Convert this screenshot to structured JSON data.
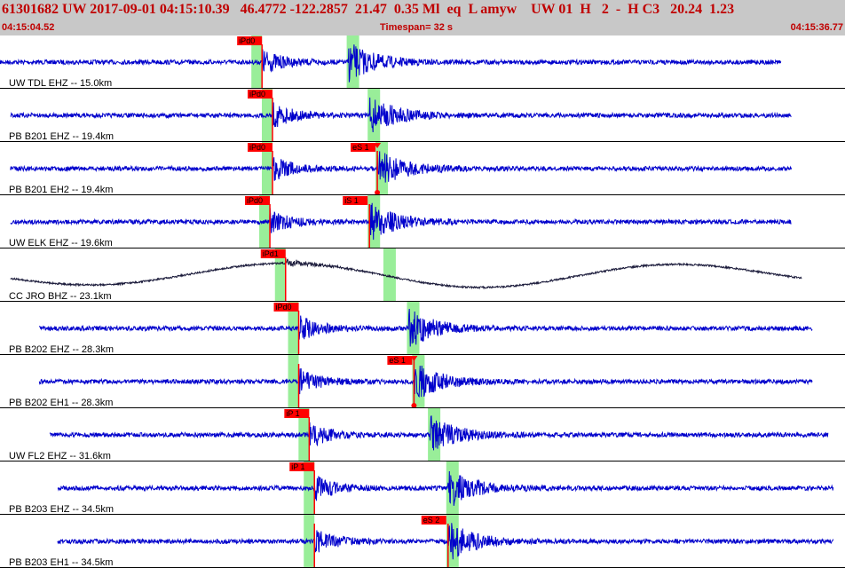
{
  "header": {
    "event_line": "61301682 UW 2017-09-01 04:15:10.39   46.4772 -122.2857  21.47  0.35 Ml  eq  L amyw    UW 01  H   2  -  H C3   20.24  1.23",
    "time_start": "04:15:04.52",
    "timespan": "Timespan=  32 s",
    "time_end": "04:15:36.77"
  },
  "colors": {
    "header_bg": "#c8c8c8",
    "header_text": "#c00000",
    "trace_blue": "#0000cc",
    "trace_dark": "#1a1a3a",
    "pick_box": "#ff0000",
    "pick_window": "#99ee99",
    "separator": "#000000"
  },
  "traces": [
    {
      "label": "UW TDL EHZ -- 15.0km",
      "color": "blue",
      "kind": "quake",
      "start_t": 0.0,
      "end_t": 29.8,
      "pickP_t": 10.0,
      "pickS_t": 13.3,
      "p_label": "iPd0",
      "s_label": "",
      "s_marker": false
    },
    {
      "label": "PB B201 EHZ -- 19.4km",
      "color": "blue",
      "kind": "quake",
      "start_t": 0.4,
      "end_t": 30.2,
      "pickP_t": 10.4,
      "pickS_t": 14.1,
      "p_label": "iPd0",
      "s_label": "",
      "s_marker": false
    },
    {
      "label": "PB B201 EH2 -- 19.4km",
      "color": "blue",
      "kind": "quake",
      "start_t": 0.4,
      "end_t": 30.2,
      "pickP_t": 10.4,
      "pickS_t": 14.4,
      "p_label": "iPd0",
      "s_label": "eS 1",
      "s_marker": true
    },
    {
      "label": "UW ELK EHZ -- 19.6km",
      "color": "blue",
      "kind": "quake",
      "start_t": 0.4,
      "end_t": 30.2,
      "pickP_t": 10.3,
      "pickS_t": 14.1,
      "p_label": "iPd0",
      "s_label": "iS 1",
      "s_marker": false
    },
    {
      "label": "CC JRO BHZ -- 23.1km",
      "color": "dark",
      "kind": "long",
      "start_t": 0.4,
      "end_t": 30.6,
      "pickP_t": 10.9,
      "pickS_t": 14.7,
      "p_label": "iPd1",
      "s_label": "",
      "s_marker": false
    },
    {
      "label": "PB B202 EHZ -- 28.3km",
      "color": "blue",
      "kind": "quake",
      "start_t": 1.5,
      "end_t": 31.0,
      "pickP_t": 11.4,
      "pickS_t": 15.6,
      "p_label": "iPd0",
      "s_label": "",
      "s_marker": false
    },
    {
      "label": "PB B202 EH1 -- 28.3km",
      "color": "blue",
      "kind": "quake",
      "start_t": 1.5,
      "end_t": 31.0,
      "pickP_t": 11.4,
      "pickS_t": 15.8,
      "p_label": "eS 1",
      "s_label": "",
      "s_marker": true,
      "label_at_s": true
    },
    {
      "label": "UW FL2 EHZ -- 31.6km",
      "color": "blue",
      "kind": "quake",
      "start_t": 1.9,
      "end_t": 31.6,
      "pickP_t": 11.8,
      "pickS_t": 16.4,
      "p_label": "iP 1",
      "s_label": "",
      "s_marker": false
    },
    {
      "label": "PB B203 EHZ -- 34.5km",
      "color": "blue",
      "kind": "quake",
      "start_t": 2.2,
      "end_t": 31.8,
      "pickP_t": 12.0,
      "pickS_t": 17.1,
      "p_label": "iP 1",
      "s_label": "",
      "s_marker": false
    },
    {
      "label": "PB B203 EH1 -- 34.5km",
      "color": "blue",
      "kind": "quake",
      "start_t": 2.2,
      "end_t": 31.8,
      "pickP_t": 12.0,
      "pickS_t": 17.1,
      "p_label": "",
      "s_label": "eS 2",
      "s_marker": false
    }
  ]
}
